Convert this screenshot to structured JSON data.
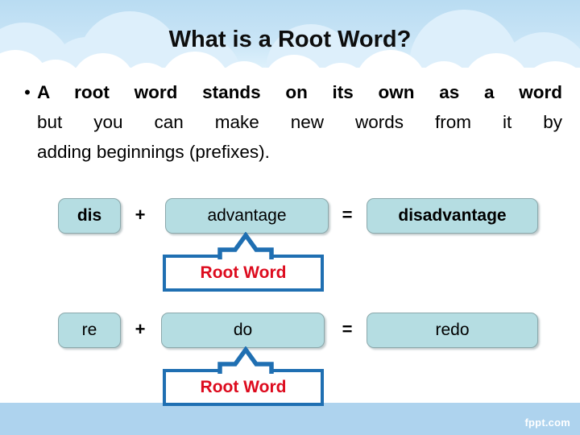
{
  "slide": {
    "title": "What is a Root Word?",
    "bullet_marker": "•",
    "body_lines": [
      "A root word stands on its own as a word",
      "but you can make new words from it by",
      "adding beginnings (prefixes)."
    ],
    "footer_watermark": "fppt.com"
  },
  "equations": [
    {
      "prefix": "dis",
      "operator_plus": "+",
      "root": "advantage",
      "operator_equals": "=",
      "result": "disadvantage",
      "callout_label": "Root Word"
    },
    {
      "prefix": "re",
      "operator_plus": "+",
      "root": "do",
      "operator_equals": "=",
      "result": "redo",
      "callout_label": "Root Word"
    }
  ],
  "colors": {
    "box_fill": "#b5dde2",
    "box_border": "#8ba8ab",
    "callout_border": "#1f6fb2",
    "callout_text": "#dd0b1e",
    "arrow": "#1f6fb2",
    "sky_top": "#b9dcf2",
    "footer_band": "#aed3ee",
    "title_text": "#0d0d0d"
  }
}
